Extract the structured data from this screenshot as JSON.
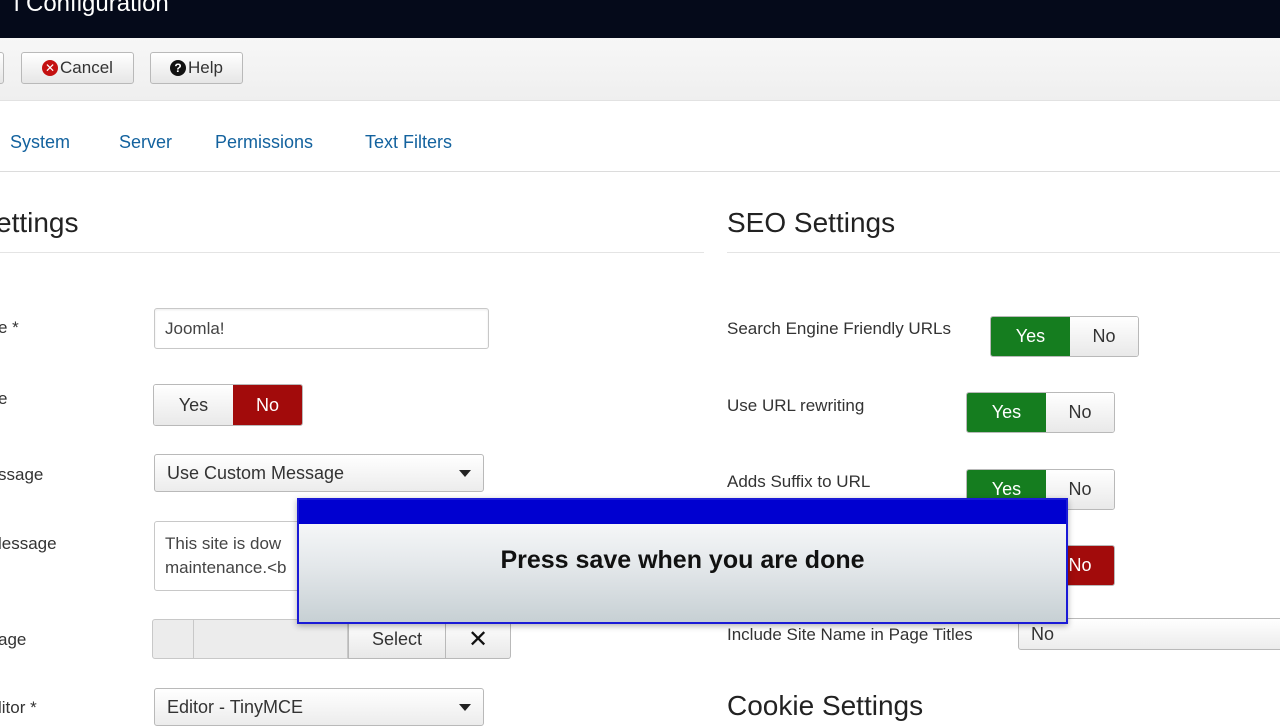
{
  "header": {
    "title": "l Configuration"
  },
  "toolbar": {
    "cancel_label": "Cancel",
    "help_label": "Help"
  },
  "tabs": [
    {
      "label": "System"
    },
    {
      "label": "Server"
    },
    {
      "label": "Permissions"
    },
    {
      "label": "Text Filters"
    }
  ],
  "site_settings": {
    "title": "ettings",
    "site_name": {
      "label": "e *",
      "value": "Joomla!"
    },
    "site_offline": {
      "label": "e",
      "yes": "Yes",
      "no": "No",
      "selected": "No"
    },
    "offline_message": {
      "label": "ssage",
      "value": "Use Custom Message"
    },
    "custom_message": {
      "label": "lessage",
      "line1": "This site is dow",
      "line2": "maintenance.<b"
    },
    "offline_image": {
      "label": "age",
      "select_label": "Select",
      "clear_icon": "close-icon"
    },
    "default_editor": {
      "label": "litor *",
      "value": "Editor - TinyMCE"
    }
  },
  "seo_settings": {
    "title": "SEO Settings",
    "sef_urls": {
      "label": "Search Engine Friendly URLs",
      "yes": "Yes",
      "no": "No",
      "selected": "Yes"
    },
    "url_rewriting": {
      "label": "Use URL rewriting",
      "yes": "Yes",
      "no": "No",
      "selected": "Yes"
    },
    "suffix": {
      "label": "Adds Suffix to URL",
      "yes": "Yes",
      "no": "No",
      "selected": "Yes"
    },
    "unicode_aliases": {
      "no": "No",
      "selected": "No"
    },
    "site_name_titles": {
      "label": "Include Site Name in Page Titles",
      "value": "No"
    }
  },
  "cookie_settings": {
    "title": "Cookie Settings"
  },
  "overlay": {
    "message": "Press save when you are done"
  },
  "colors": {
    "yes_active": "#157d1f",
    "no_active": "#a20b0b",
    "link": "#13629e",
    "overlay_bar": "#0000d0"
  }
}
